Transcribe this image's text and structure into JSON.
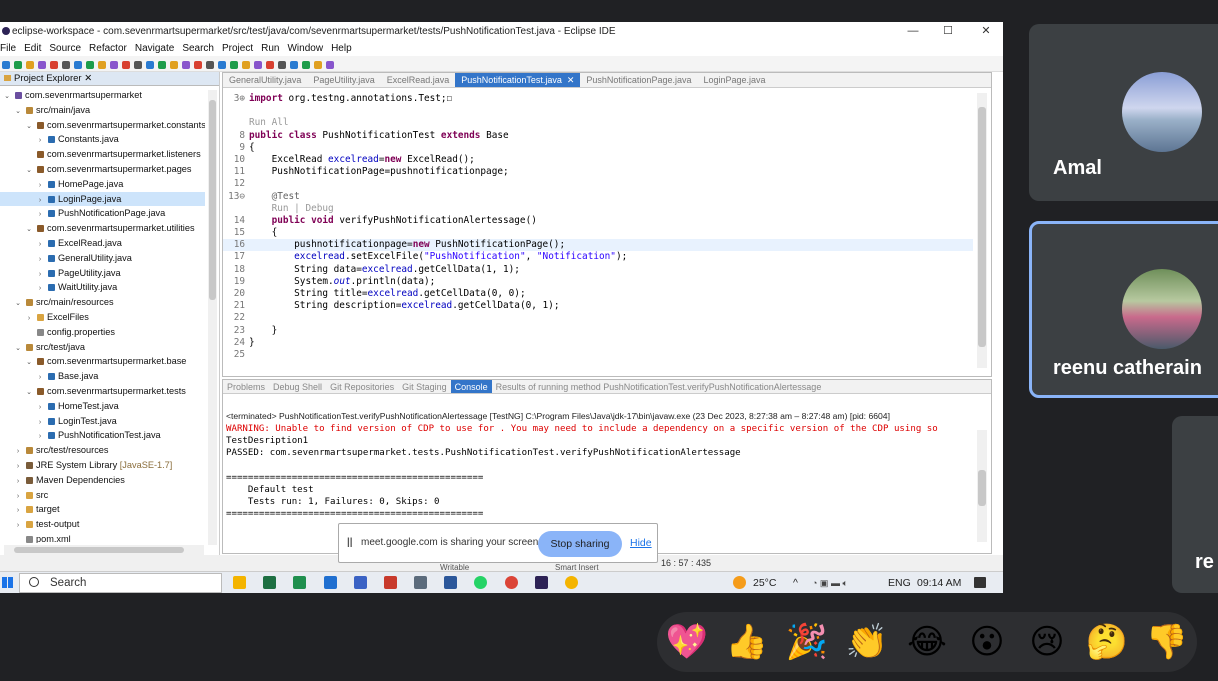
{
  "window": {
    "title": "eclipse-workspace - com.sevenrmartsupermarket/src/test/java/com/sevenrmartsupermarket/tests/PushNotificationTest.java - Eclipse IDE",
    "minimize": "—",
    "maximize": "☐",
    "close": "✕"
  },
  "menu": [
    "File",
    "Edit",
    "Source",
    "Refactor",
    "Navigate",
    "Search",
    "Project",
    "Run",
    "Window",
    "Help"
  ],
  "project_explorer": {
    "tab_label": "Project Explorer",
    "tree": [
      {
        "label": "com.sevenrmartsupermarket",
        "indent": 0,
        "twisty": "⌄",
        "icon": "project-icon"
      },
      {
        "label": "src/main/java",
        "indent": 1,
        "twisty": "⌄",
        "icon": "source-folder-icon"
      },
      {
        "label": "com.sevenrmartsupermarket.constants",
        "indent": 2,
        "twisty": "⌄",
        "icon": "package-icon"
      },
      {
        "label": "Constants.java",
        "indent": 3,
        "twisty": "›",
        "icon": "java-file-icon"
      },
      {
        "label": "com.sevenrmartsupermarket.listeners",
        "indent": 2,
        "twisty": "",
        "icon": "package-icon"
      },
      {
        "label": "com.sevenrmartsupermarket.pages",
        "indent": 2,
        "twisty": "⌄",
        "icon": "package-icon"
      },
      {
        "label": "HomePage.java",
        "indent": 3,
        "twisty": "›",
        "icon": "java-file-icon"
      },
      {
        "label": "LoginPage.java",
        "indent": 3,
        "twisty": "›",
        "icon": "java-file-icon",
        "selected": true
      },
      {
        "label": "PushNotificationPage.java",
        "indent": 3,
        "twisty": "›",
        "icon": "java-file-icon"
      },
      {
        "label": "com.sevenrmartsupermarket.utilities",
        "indent": 2,
        "twisty": "⌄",
        "icon": "package-icon",
        "hover": true
      },
      {
        "label": "ExcelRead.java",
        "indent": 3,
        "twisty": "›",
        "icon": "java-file-icon"
      },
      {
        "label": "GeneralUtility.java",
        "indent": 3,
        "twisty": "›",
        "icon": "java-file-icon"
      },
      {
        "label": "PageUtility.java",
        "indent": 3,
        "twisty": "›",
        "icon": "java-file-icon"
      },
      {
        "label": "WaitUtility.java",
        "indent": 3,
        "twisty": "›",
        "icon": "java-file-icon"
      },
      {
        "label": "src/main/resources",
        "indent": 1,
        "twisty": "⌄",
        "icon": "source-folder-icon"
      },
      {
        "label": "ExcelFiles",
        "indent": 2,
        "twisty": "›",
        "icon": "folder-icon"
      },
      {
        "label": "config.properties",
        "indent": 2,
        "twisty": "",
        "icon": "file-icon"
      },
      {
        "label": "src/test/java",
        "indent": 1,
        "twisty": "⌄",
        "icon": "source-folder-icon"
      },
      {
        "label": "com.sevenrmartsupermarket.base",
        "indent": 2,
        "twisty": "⌄",
        "icon": "package-icon"
      },
      {
        "label": "Base.java",
        "indent": 3,
        "twisty": "›",
        "icon": "java-file-icon"
      },
      {
        "label": "com.sevenrmartsupermarket.tests",
        "indent": 2,
        "twisty": "⌄",
        "icon": "package-icon"
      },
      {
        "label": "HomeTest.java",
        "indent": 3,
        "twisty": "›",
        "icon": "java-file-icon"
      },
      {
        "label": "LoginTest.java",
        "indent": 3,
        "twisty": "›",
        "icon": "java-file-icon"
      },
      {
        "label": "PushNotificationTest.java",
        "indent": 3,
        "twisty": "›",
        "icon": "java-file-icon"
      },
      {
        "label": "src/test/resources",
        "indent": 1,
        "twisty": "›",
        "icon": "source-folder-icon"
      },
      {
        "label": "JRE System Library",
        "suffix": " [JavaSE-1.7]",
        "indent": 1,
        "twisty": "›",
        "icon": "library-icon"
      },
      {
        "label": "Maven Dependencies",
        "indent": 1,
        "twisty": "›",
        "icon": "library-icon"
      },
      {
        "label": "src",
        "indent": 1,
        "twisty": "›",
        "icon": "folder-icon"
      },
      {
        "label": "target",
        "indent": 1,
        "twisty": "›",
        "icon": "folder-icon"
      },
      {
        "label": "test-output",
        "indent": 1,
        "twisty": "›",
        "icon": "folder-icon"
      },
      {
        "label": "pom.xml",
        "indent": 1,
        "twisty": "",
        "icon": "file-icon"
      }
    ]
  },
  "editor": {
    "tabs": [
      {
        "label": "GeneralUtility.java",
        "active": false
      },
      {
        "label": "PageUtility.java",
        "active": false
      },
      {
        "label": "ExcelRead.java",
        "active": false
      },
      {
        "label": "PushNotificationTest.java",
        "active": true
      },
      {
        "label": "PushNotificationPage.java",
        "active": false
      },
      {
        "label": "LoginPage.java",
        "active": false
      }
    ],
    "lines": [
      {
        "n": "3⊕",
        "html": "<span class=\"kw\">import</span> org.testng.annotations.Test;☐"
      },
      {
        "n": "",
        "html": ""
      },
      {
        "n": "",
        "html": "<span class=\"mini\">Run All</span>"
      },
      {
        "n": "8",
        "html": "<span class=\"kw\">public class</span> PushNotificationTest <span class=\"kw\">extends</span> Base"
      },
      {
        "n": "9",
        "html": "{"
      },
      {
        "n": "10",
        "html": "    ExcelRead <span class=\"fld\">excelread</span>=<span class=\"kw\">new</span> ExcelRead();"
      },
      {
        "n": "11",
        "html": "    PushNotificationPage=pushnotificationpage;"
      },
      {
        "n": "12",
        "html": ""
      },
      {
        "n": "13⊖",
        "html": "    <span class=\"ann\">@Test</span>"
      },
      {
        "n": "",
        "html": "    <span class=\"mini\">Run | Debug</span>"
      },
      {
        "n": "14",
        "html": "    <span class=\"kw\">public void</span> verifyPushNotificationAlertessage()"
      },
      {
        "n": "15",
        "html": "    {"
      },
      {
        "n": "16",
        "html": "        pushnotificationpage=<span class=\"kw\">new</span> PushNotificationPage();",
        "highlight": true
      },
      {
        "n": "17",
        "html": "        <span class=\"fld\">excelread</span>.setExcelFile(<span class=\"str\">\"PushNotification\"</span>, <span class=\"str\">\"Notification\"</span>);"
      },
      {
        "n": "18",
        "html": "        String data=<span class=\"fld\">excelread</span>.getCellData(1, 1);"
      },
      {
        "n": "19",
        "html": "        System.<span class=\"fld\"><i>out</i></span>.println(data);"
      },
      {
        "n": "20",
        "html": "        String title=<span class=\"fld\">excelread</span>.getCellData(0, 0);"
      },
      {
        "n": "21",
        "html": "        String description=<span class=\"fld\">excelread</span>.getCellData(0, 1);"
      },
      {
        "n": "22",
        "html": ""
      },
      {
        "n": "23",
        "html": "    }"
      },
      {
        "n": "24",
        "html": "}"
      },
      {
        "n": "25",
        "html": ""
      }
    ]
  },
  "console": {
    "tabs": [
      {
        "label": "Problems",
        "active": false
      },
      {
        "label": "Debug Shell",
        "active": false
      },
      {
        "label": "Git Repositories",
        "active": false
      },
      {
        "label": "Git Staging",
        "active": false
      },
      {
        "label": "Console",
        "active": true
      },
      {
        "label": "Results of running method PushNotificationTest.verifyPushNotificationAlertessage",
        "active": false
      }
    ],
    "terminated": "<terminated> PushNotificationTest.verifyPushNotificationAlertessage [TestNG] C:\\Program Files\\Java\\jdk-17\\bin\\javaw.exe (23 Dec 2023, 8:27:38 am – 8:27:48 am) [pid: 6604]",
    "output": [
      {
        "text": "WARNING: Unable to find version of CDP to use for . You may need to include a dependency on a specific version of the CDP using so",
        "warn": true
      },
      {
        "text": "TestDesription1",
        "warn": false
      },
      {
        "text": "PASSED: com.sevenrmartsupermarket.tests.PushNotificationTest.verifyPushNotificationAlertessage",
        "warn": false
      },
      {
        "text": "",
        "warn": false
      },
      {
        "text": "===============================================",
        "warn": false
      },
      {
        "text": "    Default test",
        "warn": false
      },
      {
        "text": "    Tests run: 1, Failures: 0, Skips: 0",
        "warn": false
      },
      {
        "text": "===============================================",
        "warn": false
      }
    ]
  },
  "statusbar": {
    "writable": "Writable",
    "insert_mode": "Smart Insert",
    "position": "16 : 57 : 435"
  },
  "share_banner": {
    "text": "meet.google.com is sharing your screen.",
    "stop_label": "Stop sharing",
    "hide_label": "Hide"
  },
  "taskbar": {
    "search_label": "Search",
    "weather": "25°C",
    "language": "ENG",
    "time": "09:14 AM"
  },
  "participants": [
    {
      "name": "Amal"
    },
    {
      "name": "reenu catherain",
      "speaking": true
    },
    {
      "name": "re"
    }
  ],
  "reactions": [
    "💖",
    "👍",
    "🎉",
    "👏",
    "😂",
    "😮",
    "😢",
    "🤔",
    "👎"
  ],
  "colors": {
    "accent": "#3375c9",
    "meet_blue": "#8ab4f8",
    "meet_bg": "#202124",
    "tile_bg": "#3c4043"
  }
}
